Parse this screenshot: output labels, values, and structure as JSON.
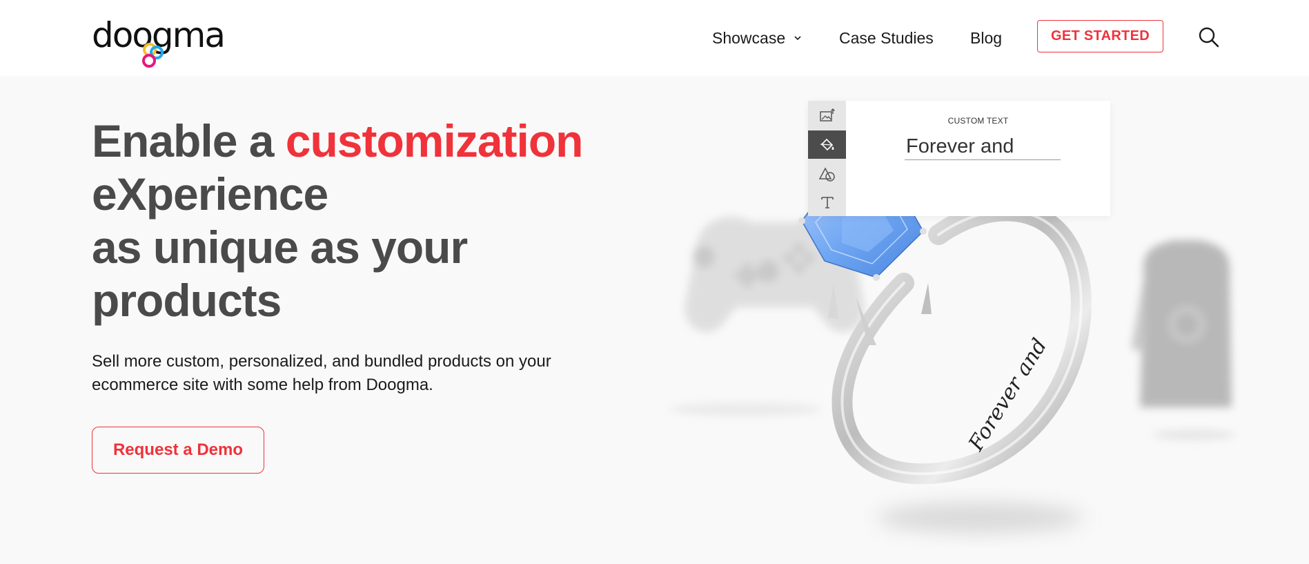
{
  "header": {
    "logo_text": "doogma",
    "nav": {
      "showcase": "Showcase",
      "case_studies": "Case Studies",
      "blog": "Blog"
    },
    "cta": "GET STARTED"
  },
  "hero": {
    "title_prefix": "Enable a ",
    "title_accent": "customization",
    "title_rest_1": "eXperience",
    "title_rest_2": "as unique as your",
    "title_rest_3": "products",
    "subtitle": "Sell more custom, personalized, and bundled products on your ecommerce site with some help from Doogma.",
    "demo_button": "Request a Demo"
  },
  "customizer": {
    "label": "CUSTOM TEXT",
    "input_value": "Forever and",
    "engraving": "Forever and",
    "tools": [
      "image-upload-icon",
      "paint-bucket-icon",
      "shapes-icon",
      "text-icon"
    ],
    "active_tool": "paint-bucket-icon"
  },
  "colors": {
    "accent": "#f0323a",
    "heading": "#4a4a4a",
    "gem": "#6fa6f2"
  }
}
